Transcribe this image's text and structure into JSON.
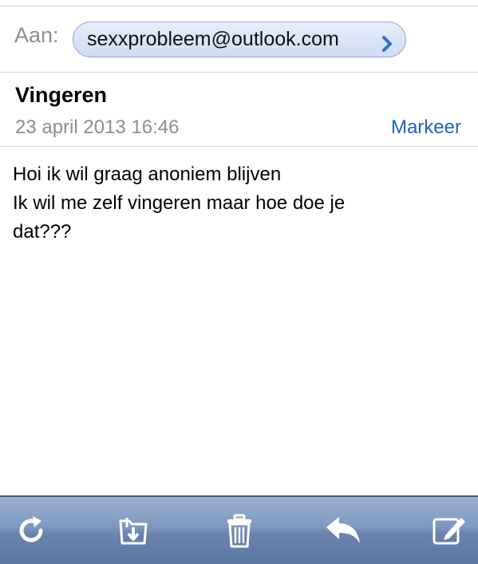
{
  "header": {
    "to_label": "Aan:",
    "recipient": "sexxprobleem@outlook.com"
  },
  "message": {
    "subject": "Vingeren",
    "date": "23 april 2013 16:46",
    "flag_label": "Markeer",
    "body_lines": [
      "Hoi ik wil graag anoniem blijven",
      "Ik wil me zelf vingeren maar hoe doe je",
      "dat???"
    ]
  },
  "toolbar": {
    "icons": [
      "refresh-icon",
      "move-to-folder-icon",
      "trash-icon",
      "reply-icon",
      "compose-icon"
    ]
  },
  "colors": {
    "accent": "#1f66b8",
    "toolbar": "#7f97be"
  }
}
